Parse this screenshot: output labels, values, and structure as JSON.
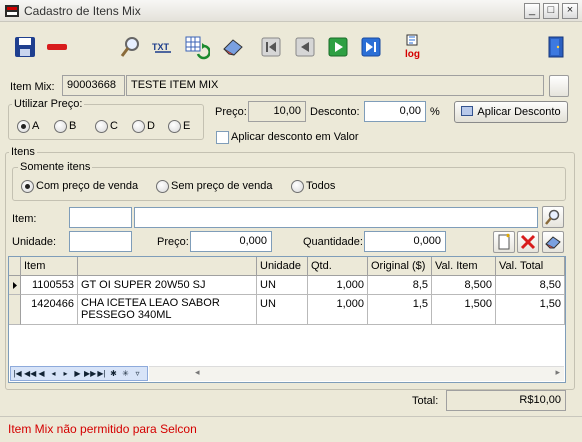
{
  "window": {
    "title": "Cadastro de Itens Mix",
    "minimize": "_",
    "maximize": "□",
    "close": "×"
  },
  "toolbar": {
    "save": "save-icon",
    "delete": "minus-icon",
    "search": "magnifier-icon",
    "txt_label": "TXT",
    "refresh": "refresh-grid-icon",
    "edit": "eraser-icon",
    "first": "first-icon",
    "prev": "prev-icon",
    "next": "next-icon",
    "last": "last-icon",
    "log_label": "log",
    "exit": "exit-door-icon"
  },
  "item_mix": {
    "label": "Item Mix:",
    "code": "90003668",
    "name": "TESTE ITEM MIX"
  },
  "price_option": {
    "title": "Utilizar Preço:",
    "options": [
      "A",
      "B",
      "C",
      "D",
      "E"
    ],
    "selected": "A"
  },
  "pricing": {
    "price_label": "Preço:",
    "price_value": "10,00",
    "discount_label": "Desconto:",
    "discount_value": "0,00",
    "percent": "%",
    "apply_button": "Aplicar Desconto",
    "value_discount_label": "Aplicar desconto em Valor"
  },
  "items": {
    "title": "Itens",
    "filter_title": "Somente itens",
    "filters": [
      "Com preço de venda",
      "Sem preço de venda",
      "Todos"
    ],
    "filter_selected": "Com preço de venda",
    "item_label": "Item:",
    "item_code": "",
    "item_desc": "",
    "unit_label": "Unidade:",
    "unit_value": "",
    "price_label": "Preço:",
    "price_value": "0,000",
    "qty_label": "Quantidade:",
    "qty_value": "0,000"
  },
  "grid": {
    "columns": [
      "Item",
      "",
      "Unidade",
      "Qtd.",
      "Original ($)",
      "Val. Item",
      "Val. Total"
    ],
    "rows": [
      {
        "item": "1100553",
        "desc": "GT OI SUPER 20W50 SJ",
        "unit": "UN",
        "qty": "1,000",
        "original": "8,5",
        "val_item": "8,500",
        "val_total": "8,50",
        "current": true
      },
      {
        "item": "1420466",
        "desc": "CHA ICETEA LEAO SABOR PESSEGO 340ML",
        "unit": "UN",
        "qty": "1,000",
        "original": "1,5",
        "val_item": "1,500",
        "val_total": "1,50",
        "current": false
      }
    ]
  },
  "total": {
    "label": "Total:",
    "value": "R$10,00"
  },
  "status": {
    "message": "Item Mix não permitido para Selcon"
  }
}
